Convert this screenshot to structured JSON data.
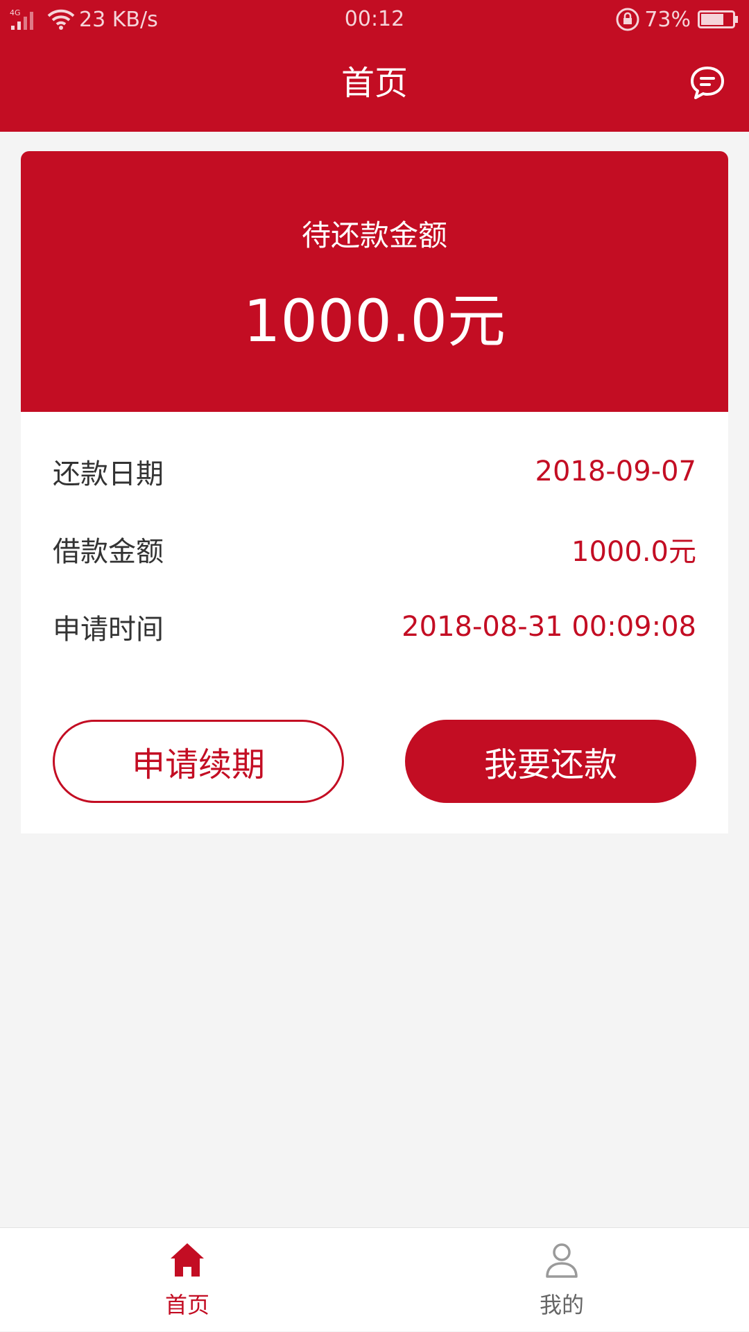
{
  "status_bar": {
    "network": "4G",
    "speed": "23 KB/s",
    "time": "00:12",
    "battery": "73%",
    "battery_level": 0.73
  },
  "nav": {
    "title": "首页",
    "message_icon": "chat-bubble-icon"
  },
  "summary": {
    "label": "待还款金额",
    "amount": "1000.0元"
  },
  "details": [
    {
      "label": "还款日期",
      "value": "2018-09-07"
    },
    {
      "label": "借款金额",
      "value": "1000.0元"
    },
    {
      "label": "申请时间",
      "value": "2018-08-31 00:09:08"
    }
  ],
  "actions": {
    "renew": "申请续期",
    "repay": "我要还款"
  },
  "tabs": [
    {
      "label": "首页",
      "icon": "home-icon",
      "active": true
    },
    {
      "label": "我的",
      "icon": "user-icon",
      "active": false
    }
  ],
  "colors": {
    "primary": "#c30d23",
    "inactive": "#9a9a9a",
    "background": "#f4f4f4"
  }
}
